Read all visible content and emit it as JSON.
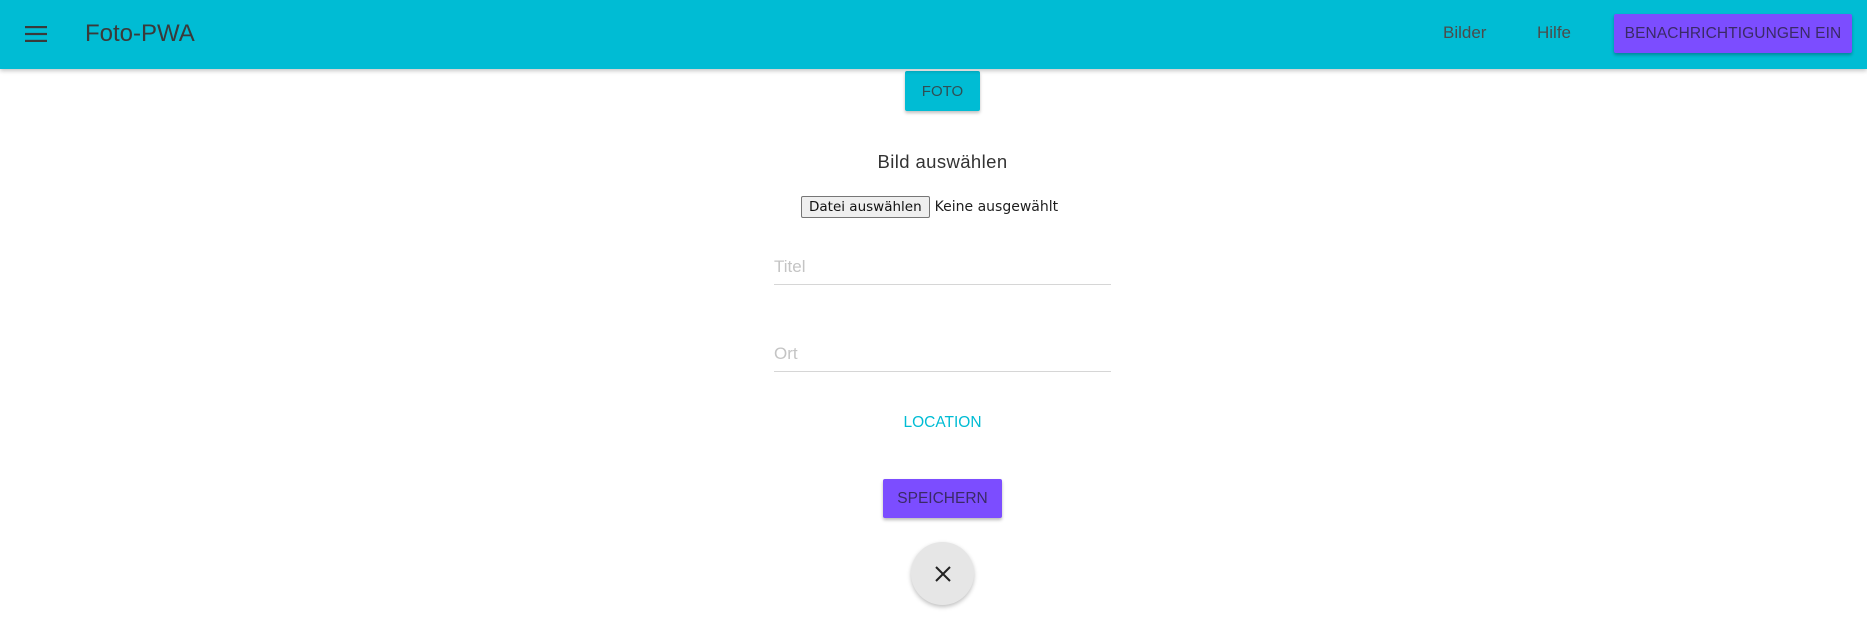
{
  "app": {
    "title": "Foto-PWA",
    "menu_icon": "hamburger-menu-icon"
  },
  "nav": {
    "links": [
      {
        "label": "Bilder"
      },
      {
        "label": "Hilfe"
      }
    ],
    "notifications_button": "BENACHRICHTIGUNGEN EIN"
  },
  "form": {
    "foto_button": "FOTO",
    "image_heading": "Bild auswählen",
    "file_button": "Datei auswählen",
    "file_status": "Keine ausgewählt",
    "title_placeholder": "Titel",
    "title_value": "",
    "location_placeholder": "Ort",
    "location_value": "",
    "location_button": "LOCATION",
    "save_button": "SPEICHERN",
    "close_icon": "close-icon"
  },
  "colors": {
    "primary": "#00bcd4",
    "accent": "#7c4dff",
    "fab_background": "#e6e6e6"
  }
}
